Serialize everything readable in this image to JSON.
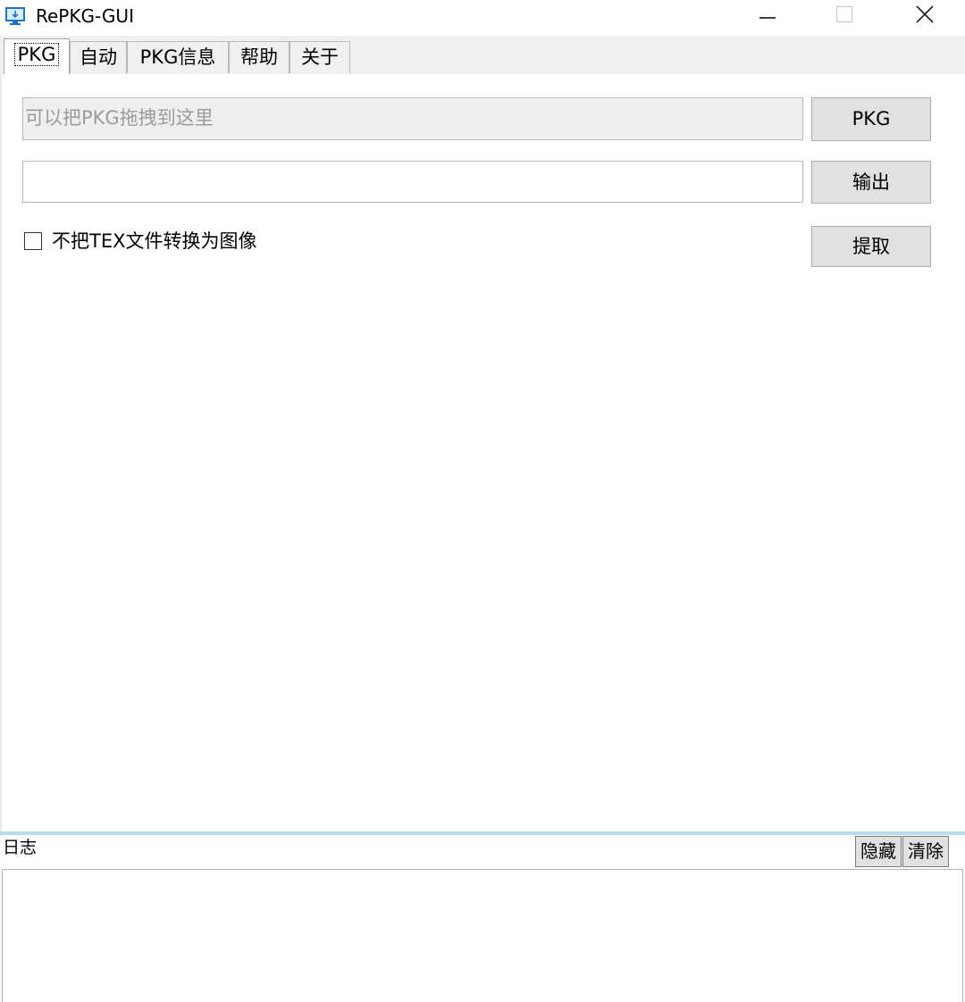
{
  "window": {
    "title": "RePKG-GUI",
    "icon": "app-monitor-icon",
    "controls": {
      "minimize_icon": "minimize-icon",
      "maximize_icon": "maximize-icon",
      "close_icon": "close-icon"
    }
  },
  "tabs": [
    {
      "label": "PKG",
      "active": true
    },
    {
      "label": "自动",
      "active": false
    },
    {
      "label": "PKG信息",
      "active": false
    },
    {
      "label": "帮助",
      "active": false
    },
    {
      "label": "关于",
      "active": false
    }
  ],
  "pkg_tab": {
    "pkg_input": {
      "value": "",
      "placeholder": "可以把PKG拖拽到这里"
    },
    "pkg_button_label": "PKG",
    "output_input": {
      "value": ""
    },
    "output_button_label": "输出",
    "no_convert_tex_checkbox": {
      "label": "不把TEX文件转换为图像",
      "checked": false
    },
    "extract_button_label": "提取"
  },
  "log": {
    "label": "日志",
    "hide_button_label": "隐藏",
    "clear_button_label": "清除",
    "content": ""
  },
  "colors": {
    "tabstrip_bg": "#f0f0f0",
    "button_bg": "#e1e1e1",
    "splitter": "#b9dde8",
    "placeholder_text": "#9b9b9b"
  }
}
